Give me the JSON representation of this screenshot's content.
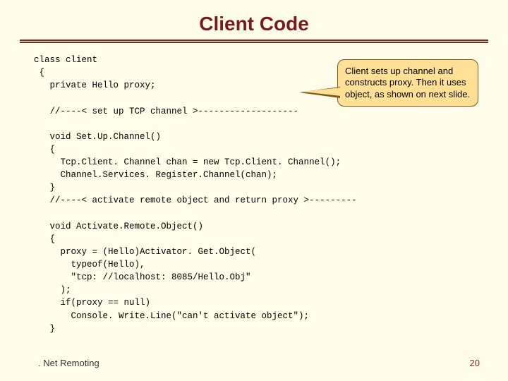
{
  "slide": {
    "title": "Client Code",
    "code": "class client\n {\n   private Hello proxy;\n\n   //----< set up TCP channel >-------------------\n\n   void Set.Up.Channel()\n   {\n     Tcp.Client. Channel chan = new Tcp.Client. Channel();\n     Channel.Services. Register.Channel(chan);\n   }\n   //----< activate remote object and return proxy >---------\n\n   void Activate.Remote.Object()\n   {\n     proxy = (Hello)Activator. Get.Object(\n       typeof(Hello),\n       \"tcp: //localhost: 8085/Hello.Obj\"\n     );\n     if(proxy == null)\n       Console. Write.Line(\"can't activate object\");\n   }",
    "callout": "Client sets up channel and constructs proxy. Then it uses object, as shown on next slide.",
    "footer_left": ". Net Remoting",
    "footer_right": "20"
  }
}
